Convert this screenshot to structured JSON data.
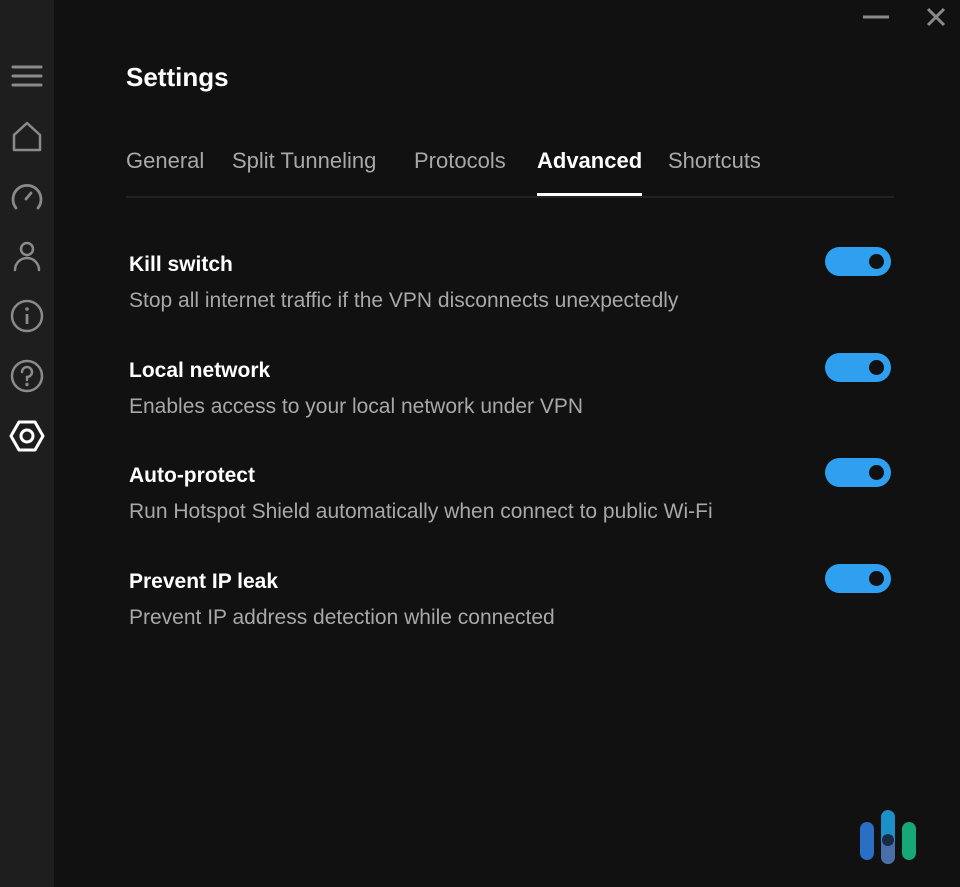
{
  "window": {
    "minimize_icon": "minimize-icon",
    "close_icon": "close-icon"
  },
  "sidebar": {
    "items": [
      {
        "name": "menu",
        "icon": "hamburger-icon",
        "active": false
      },
      {
        "name": "home",
        "icon": "home-icon",
        "active": false
      },
      {
        "name": "speed",
        "icon": "speedometer-icon",
        "active": false
      },
      {
        "name": "account",
        "icon": "user-icon",
        "active": false
      },
      {
        "name": "info",
        "icon": "info-icon",
        "active": false
      },
      {
        "name": "help",
        "icon": "help-icon",
        "active": false
      },
      {
        "name": "settings",
        "icon": "settings-hex-icon",
        "active": true
      }
    ]
  },
  "page": {
    "title": "Settings"
  },
  "tabs": [
    {
      "label": "General",
      "active": false
    },
    {
      "label": "Split Tunneling",
      "active": false
    },
    {
      "label": "Protocols",
      "active": false
    },
    {
      "label": "Advanced",
      "active": true
    },
    {
      "label": "Shortcuts",
      "active": false
    }
  ],
  "settings": [
    {
      "title": "Kill switch",
      "description": "Stop all internet traffic if the VPN disconnects unexpectedly",
      "enabled": true
    },
    {
      "title": "Local network",
      "description": "Enables access to your local network under VPN",
      "enabled": true
    },
    {
      "title": "Auto-protect",
      "description": "Run Hotspot Shield automatically when connect to public Wi-Fi",
      "enabled": true
    },
    {
      "title": "Prevent IP leak",
      "description": "Prevent IP address detection while connected",
      "enabled": true
    }
  ],
  "colors": {
    "accent": "#2f9ff0",
    "background": "#111111",
    "sidebar": "#1e1e1e",
    "text_primary": "#ffffff",
    "text_secondary": "#a8a8a8"
  },
  "watermark": {
    "icon": "brand-logo-icon"
  }
}
